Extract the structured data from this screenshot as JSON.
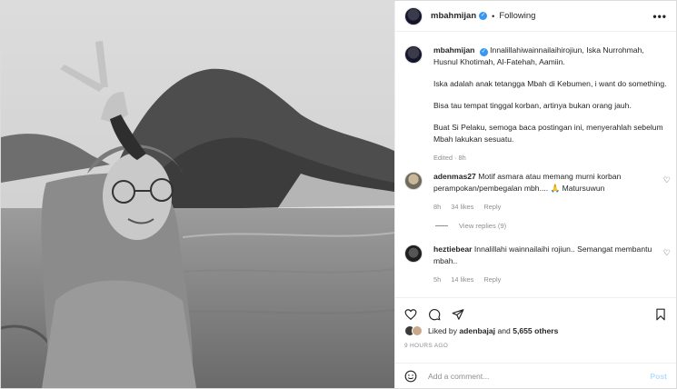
{
  "post": {
    "username": "mbahmijan",
    "separator": "•",
    "following_label": "Following",
    "more_label": "•••"
  },
  "caption": {
    "username": "mbahmijan",
    "line1": "Innalillahiwainnailaihirojiun, Iska Nurrohmah, Husnul Khotimah, Al-Fatehah, Aamiin.",
    "line2": "Iska adalah anak tetangga Mbah di Kebumen, i want do something.",
    "line3": "Bisa tau tempat tinggal korban, artinya bukan orang jauh.",
    "line4": "Buat Si Pelaku, semoga baca postingan ini, menyerahlah sebelum Mbah lakukan sesuatu.",
    "meta": "Edited · 8h"
  },
  "comments": [
    {
      "username": "adenmas27",
      "text": "Motif asmara atau memang murni korban perampokan/pembegalan mbh.... 🙏 Matursuwun",
      "age": "8h",
      "likes": "34 likes",
      "reply": "Reply",
      "view_replies": "View replies (9)"
    },
    {
      "username": "heztiebear",
      "text": "Innalillahi wainnailaihi rojiun.. Semangat membantu mbah..",
      "age": "5h",
      "likes": "14 likes",
      "reply": "Reply"
    }
  ],
  "likes": {
    "prefix": "Liked by",
    "user": "adenbajaj",
    "and": "and",
    "others": "5,655 others"
  },
  "timestamp": "9 HOURS AGO",
  "add_comment": {
    "placeholder": "Add a comment...",
    "post_label": "Post"
  },
  "icons": {
    "verified": "verified-badge-icon",
    "heart": "heart-icon",
    "comment": "comment-icon",
    "share": "share-icon",
    "save": "bookmark-icon",
    "emoji": "emoji-icon"
  },
  "colors": {
    "verified": "#3897f0",
    "muted": "#8e8e8e",
    "post_disabled": "#b2dffc"
  }
}
